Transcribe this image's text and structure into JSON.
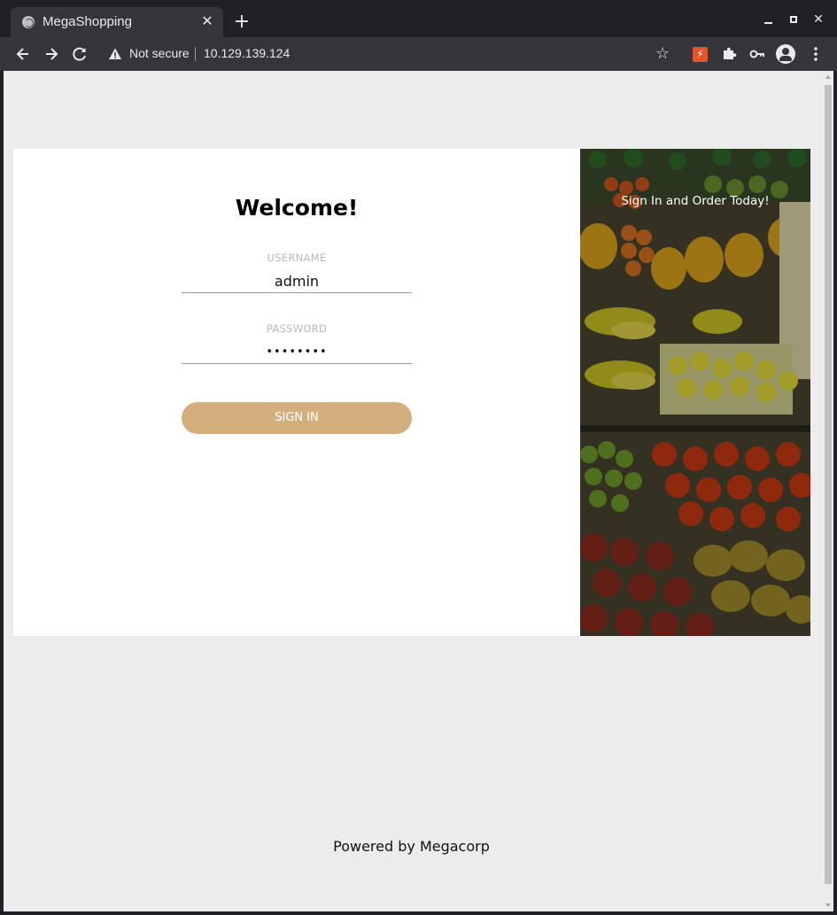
{
  "browser": {
    "tab_title": "MegaShopping",
    "security_label": "Not secure",
    "url": "10.129.139.124",
    "extension_burp_label": "⚡"
  },
  "page": {
    "title": "Welcome!",
    "username_label": "USERNAME",
    "username_value": "admin",
    "password_label": "PASSWORD",
    "password_value": "••••••••",
    "signin_label": "SIGN IN",
    "tagline": "Sign In and Order Today!",
    "footer": "Powered by Megacorp"
  },
  "colors": {
    "accent": "#d4af7e",
    "page_bg": "#ececec",
    "chrome_dark": "#202124",
    "chrome_toolbar": "#35363a"
  },
  "icons": {
    "back": "back-arrow-icon",
    "forward": "forward-arrow-icon",
    "reload": "reload-icon",
    "warning": "warning-icon",
    "bookmark": "star-icon",
    "extensions": "puzzle-icon",
    "passwords": "key-icon",
    "profile": "profile-icon",
    "menu": "kebab-menu-icon"
  }
}
